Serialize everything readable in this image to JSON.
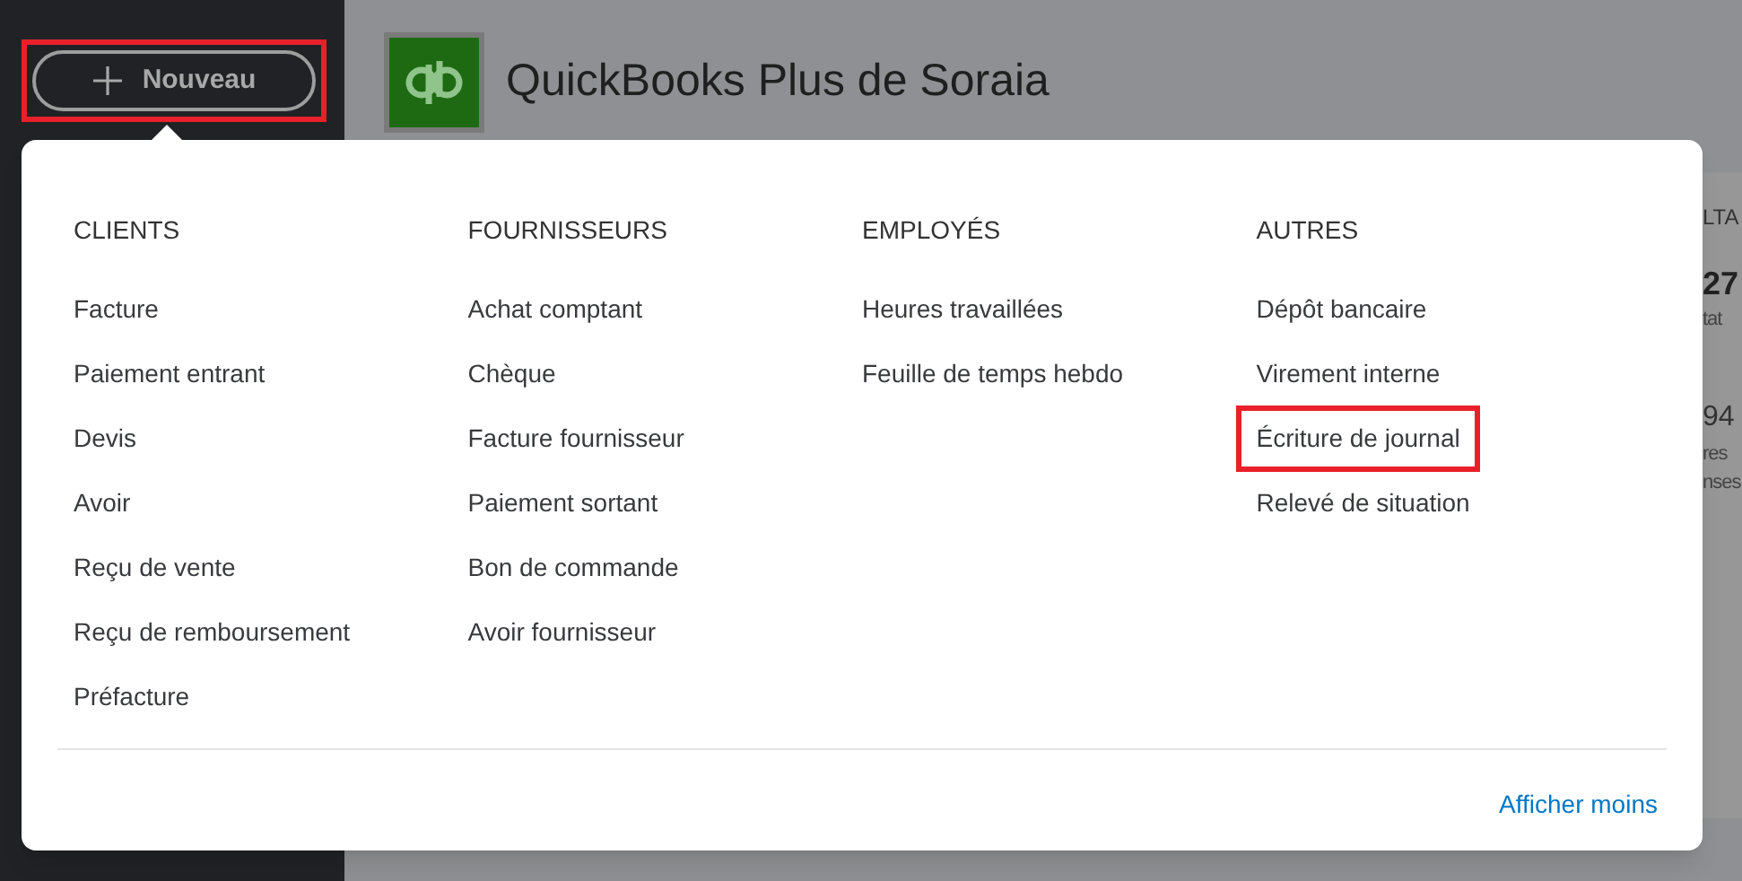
{
  "new_button": {
    "label": "Nouveau",
    "highlighted": true
  },
  "header": {
    "title": "QuickBooks Plus de Soraia"
  },
  "background_card": {
    "texts": [
      {
        "text": "LTA",
        "kind": "heading"
      },
      {
        "text": "27",
        "kind": "amount"
      },
      {
        "text": "tat",
        "kind": "caption"
      },
      {
        "text": "94",
        "kind": "number"
      },
      {
        "text": "res",
        "kind": "caption"
      },
      {
        "text": "nses",
        "kind": "caption"
      }
    ]
  },
  "menu": {
    "columns": [
      {
        "heading": "CLIENTS",
        "items": [
          {
            "label": "Facture",
            "highlighted": false
          },
          {
            "label": "Paiement entrant",
            "highlighted": false
          },
          {
            "label": "Devis",
            "highlighted": false
          },
          {
            "label": "Avoir",
            "highlighted": false
          },
          {
            "label": "Reçu de vente",
            "highlighted": false
          },
          {
            "label": "Reçu de remboursement",
            "highlighted": false
          },
          {
            "label": "Préfacture",
            "highlighted": false
          }
        ]
      },
      {
        "heading": "FOURNISSEURS",
        "items": [
          {
            "label": "Achat comptant",
            "highlighted": false
          },
          {
            "label": "Chèque",
            "highlighted": false
          },
          {
            "label": "Facture fournisseur",
            "highlighted": false
          },
          {
            "label": "Paiement sortant",
            "highlighted": false
          },
          {
            "label": "Bon de commande",
            "highlighted": false
          },
          {
            "label": "Avoir fournisseur",
            "highlighted": false
          }
        ]
      },
      {
        "heading": "EMPLOYÉS",
        "items": [
          {
            "label": "Heures travaillées",
            "highlighted": false
          },
          {
            "label": "Feuille de temps hebdo",
            "highlighted": false
          }
        ]
      },
      {
        "heading": "AUTRES",
        "items": [
          {
            "label": "Dépôt bancaire",
            "highlighted": false
          },
          {
            "label": "Virement interne",
            "highlighted": false
          },
          {
            "label": "Écriture de journal",
            "highlighted": true
          },
          {
            "label": "Relevé de situation",
            "highlighted": false
          }
        ]
      }
    ],
    "footer_link": "Afficher moins"
  }
}
